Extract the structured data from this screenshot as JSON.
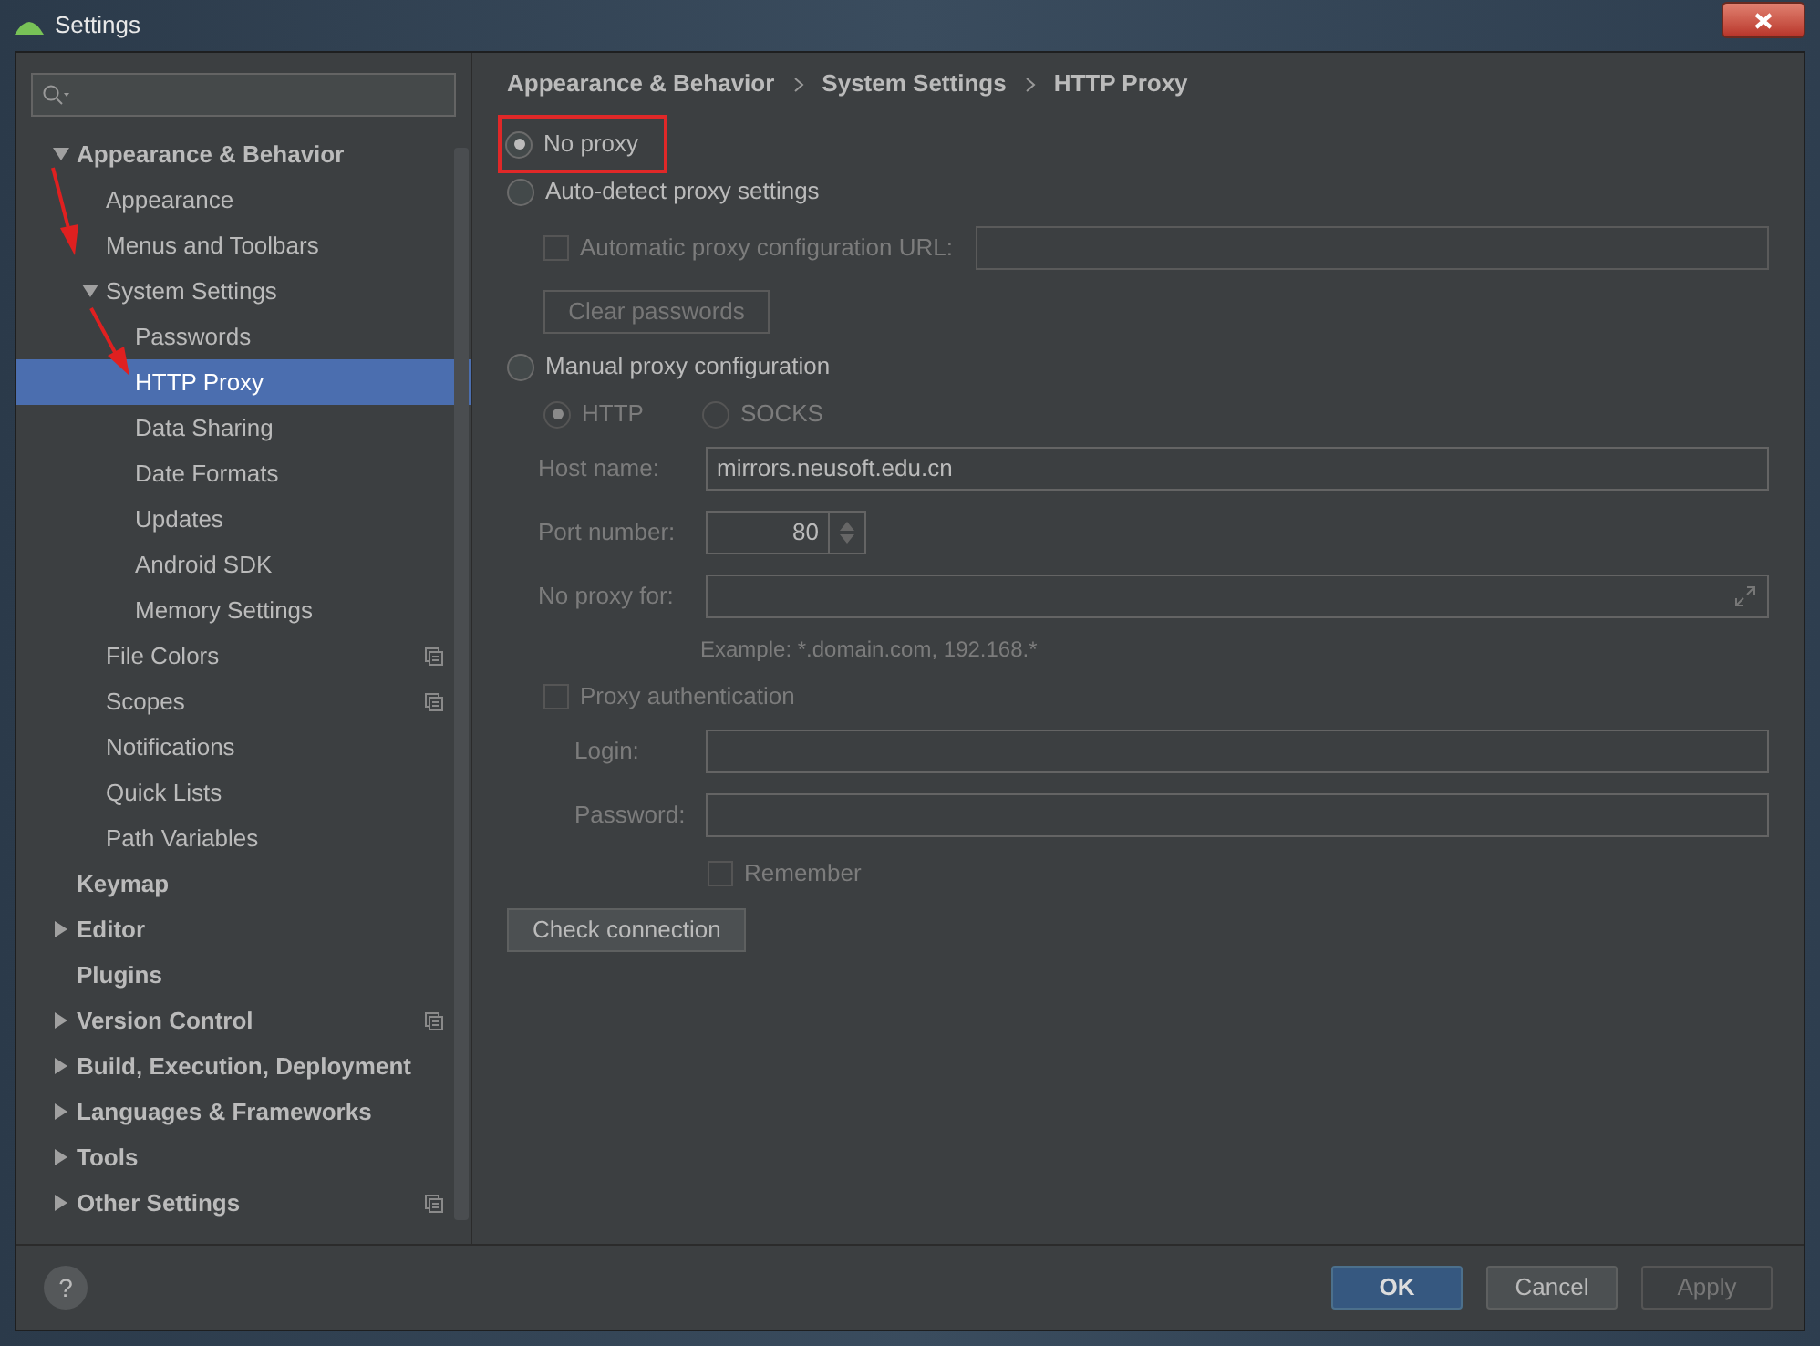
{
  "window": {
    "title": "Settings"
  },
  "tree": [
    {
      "label": "Appearance & Behavior",
      "expanded": true,
      "selected": false,
      "shared": false,
      "children": [
        {
          "label": "Appearance",
          "selected": false,
          "shared": false
        },
        {
          "label": "Menus and Toolbars",
          "selected": false,
          "shared": false
        },
        {
          "label": "System Settings",
          "expanded": true,
          "selected": false,
          "shared": false,
          "children": [
            {
              "label": "Passwords",
              "selected": false,
              "shared": false
            },
            {
              "label": "HTTP Proxy",
              "selected": true,
              "shared": false
            },
            {
              "label": "Data Sharing",
              "selected": false,
              "shared": false
            },
            {
              "label": "Date Formats",
              "selected": false,
              "shared": false
            },
            {
              "label": "Updates",
              "selected": false,
              "shared": false
            },
            {
              "label": "Android SDK",
              "selected": false,
              "shared": false
            },
            {
              "label": "Memory Settings",
              "selected": false,
              "shared": false
            }
          ]
        },
        {
          "label": "File Colors",
          "selected": false,
          "shared": true
        },
        {
          "label": "Scopes",
          "selected": false,
          "shared": true
        },
        {
          "label": "Notifications",
          "selected": false,
          "shared": false
        },
        {
          "label": "Quick Lists",
          "selected": false,
          "shared": false
        },
        {
          "label": "Path Variables",
          "selected": false,
          "shared": false
        }
      ]
    },
    {
      "label": "Keymap",
      "selected": false,
      "shared": false
    },
    {
      "label": "Editor",
      "expanded": false,
      "selected": false,
      "shared": false
    },
    {
      "label": "Plugins",
      "selected": false,
      "shared": false
    },
    {
      "label": "Version Control",
      "expanded": false,
      "selected": false,
      "shared": true
    },
    {
      "label": "Build, Execution, Deployment",
      "expanded": false,
      "selected": false,
      "shared": false
    },
    {
      "label": "Languages & Frameworks",
      "expanded": false,
      "selected": false,
      "shared": false
    },
    {
      "label": "Tools",
      "expanded": false,
      "selected": false,
      "shared": false
    },
    {
      "label": "Other Settings",
      "expanded": false,
      "selected": false,
      "shared": true
    }
  ],
  "breadcrumb": [
    "Appearance & Behavior",
    "System Settings",
    "HTTP Proxy"
  ],
  "no_proxy": {
    "label": "No proxy",
    "selected": true,
    "highlighted": true
  },
  "auto_detect": {
    "label": "Auto-detect proxy settings",
    "selected": false,
    "pac_url": {
      "label": "Automatic proxy configuration URL:",
      "checked": false,
      "disabled": true
    },
    "clear_passwords": {
      "label": "Clear passwords",
      "disabled": true
    }
  },
  "manual": {
    "label": "Manual proxy configuration",
    "selected": false,
    "disabled": true,
    "protocols": [
      {
        "label": "HTTP",
        "selected": true
      },
      {
        "label": "SOCKS",
        "selected": false
      }
    ],
    "host": {
      "label": "Host name:",
      "value": "mirrors.neusoft.edu.cn"
    },
    "port": {
      "label": "Port number:",
      "value": "80"
    },
    "no_proxy_for": {
      "label": "No proxy for:"
    },
    "example": "Example: *.domain.com, 192.168.*",
    "auth": {
      "label": "Proxy authentication",
      "checked": false
    },
    "login": {
      "label": "Login:"
    },
    "password": {
      "label": "Password:"
    },
    "remember": {
      "label": "Remember",
      "checked": false
    }
  },
  "check_connection": "Check connection",
  "help": "?",
  "buttons": [
    {
      "label": "OK",
      "kind": "primary"
    },
    {
      "label": "Cancel",
      "kind": "default"
    },
    {
      "label": "Apply",
      "kind": "disabled"
    }
  ]
}
